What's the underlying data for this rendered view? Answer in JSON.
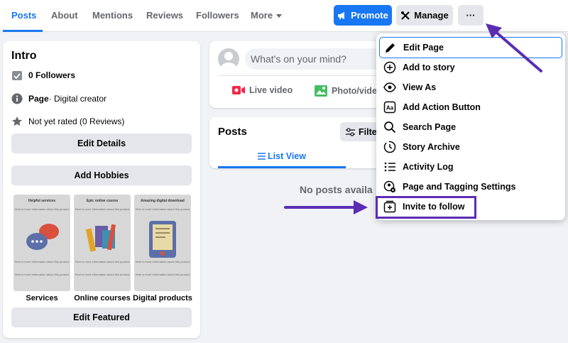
{
  "nav": {
    "tabs": [
      {
        "label": "Posts",
        "active": true
      },
      {
        "label": "About"
      },
      {
        "label": "Mentions"
      },
      {
        "label": "Reviews"
      },
      {
        "label": "Followers"
      },
      {
        "label": "More"
      }
    ],
    "promote_label": "Promote",
    "manage_label": "Manage",
    "more_label": "···",
    "colors": {
      "accent": "#1877f2",
      "annotation": "#5b2db3"
    }
  },
  "intro": {
    "title": "Intro",
    "followers": "0 Followers",
    "page_type_bold": "Page",
    "page_type_rest": " · Digital creator",
    "rating": "Not yet rated (0 Reviews)",
    "edit_details": "Edit Details",
    "add_hobbies": "Add Hobbies",
    "edit_featured": "Edit Featured",
    "featured": [
      {
        "heading": "Helpful services",
        "label": "Services",
        "line": "Here is more information about this product",
        "icon": "chat-bubbles-icon"
      },
      {
        "heading": "Epic online course",
        "label": "Online courses",
        "line": "Here is more information about this product",
        "icon": "books-icon"
      },
      {
        "heading": "Amazing digital download",
        "label": "Digital products",
        "line": "Here is more information about this product",
        "icon": "tablet-icon"
      }
    ]
  },
  "composer": {
    "placeholder": "What's on your mind?",
    "live_video": "Live video",
    "photo_video": "Photo/video"
  },
  "posts": {
    "title": "Posts",
    "filter": "Filte",
    "list_view": "List View",
    "empty": "No posts availa"
  },
  "menu": {
    "items": [
      {
        "label": "Edit Page",
        "icon": "pencil-icon"
      },
      {
        "label": "Add to story",
        "icon": "plus-circle-icon"
      },
      {
        "label": "View As",
        "icon": "eye-icon"
      },
      {
        "label": "Add Action Button",
        "icon": "action-button-icon"
      },
      {
        "label": "Search Page",
        "icon": "search-icon"
      },
      {
        "label": "Story Archive",
        "icon": "clock-icon"
      },
      {
        "label": "Activity Log",
        "icon": "list-icon"
      },
      {
        "label": "Page and Tagging Settings",
        "icon": "settings-icon"
      },
      {
        "label": "Invite to follow",
        "icon": "invite-icon"
      }
    ]
  }
}
